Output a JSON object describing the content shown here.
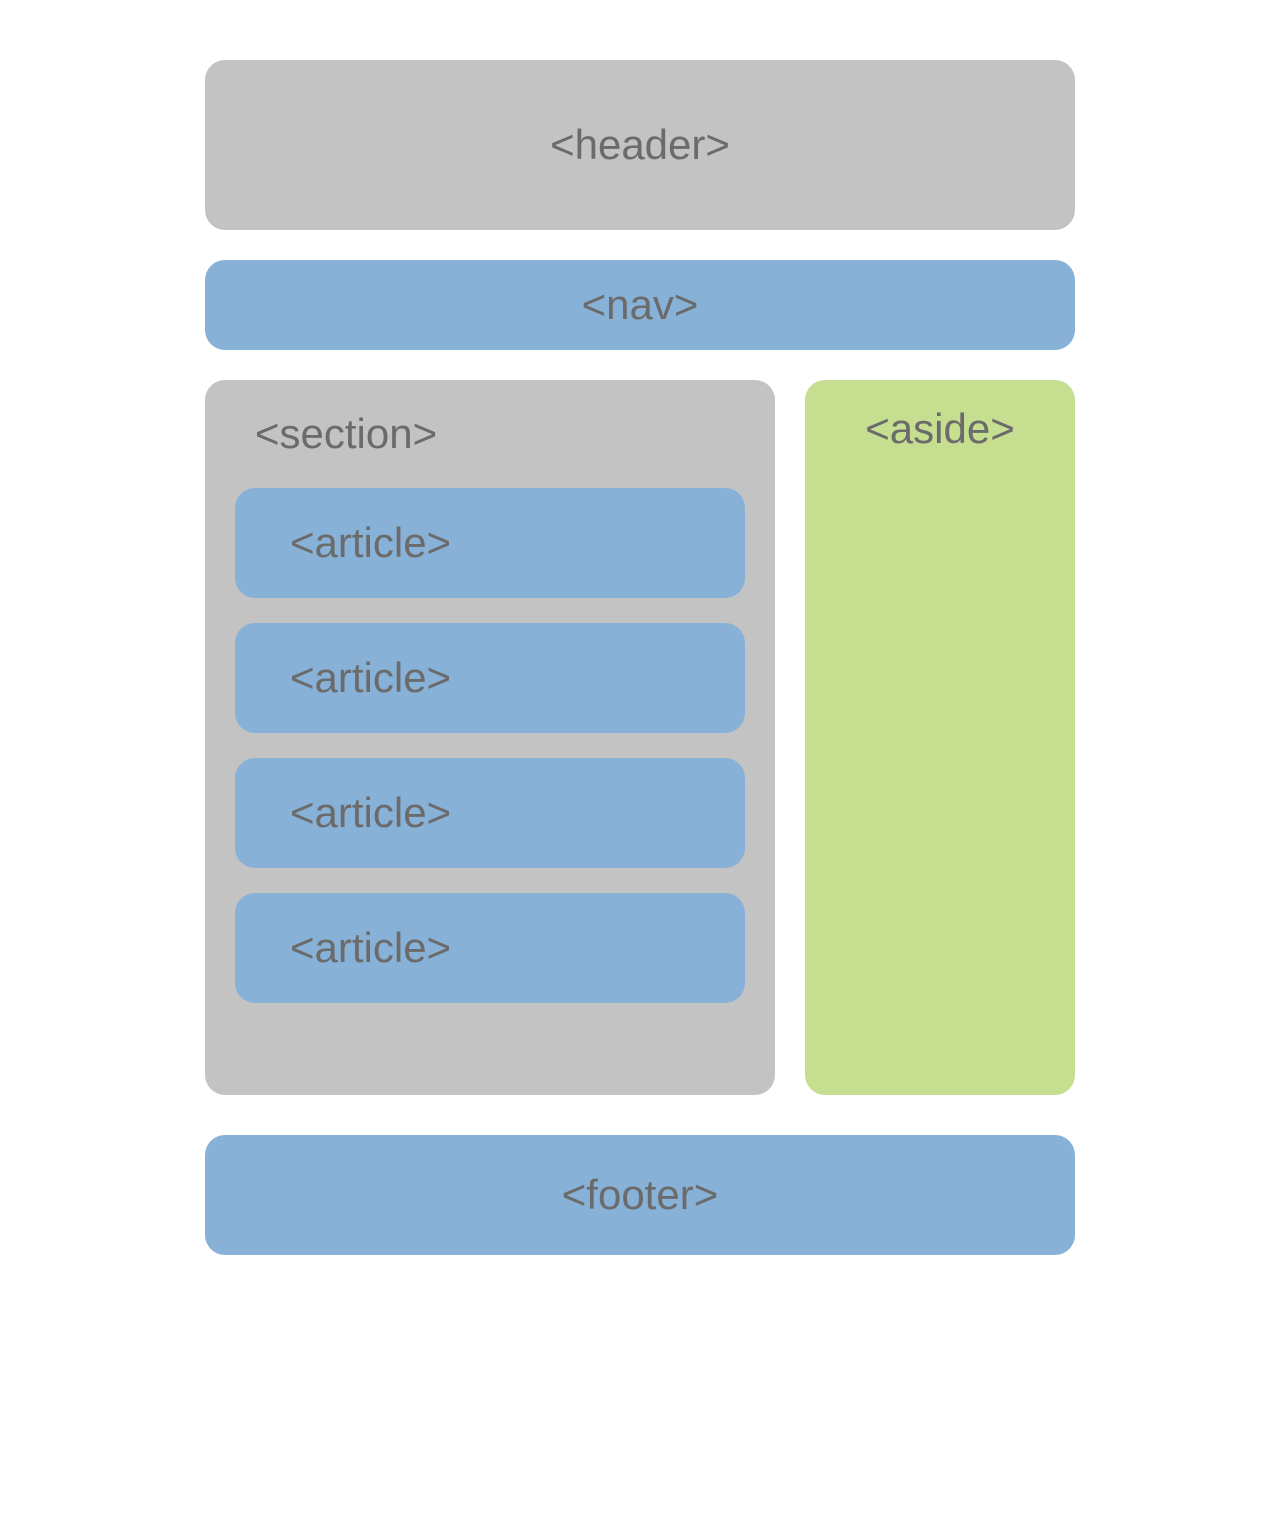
{
  "layout": {
    "header_label": "<header>",
    "nav_label": "<nav>",
    "section_label": "<section>",
    "articles": [
      {
        "label": "<article>"
      },
      {
        "label": "<article>"
      },
      {
        "label": "<article>"
      },
      {
        "label": "<article>"
      }
    ],
    "aside_label": "<aside>",
    "footer_label": "<footer>"
  }
}
